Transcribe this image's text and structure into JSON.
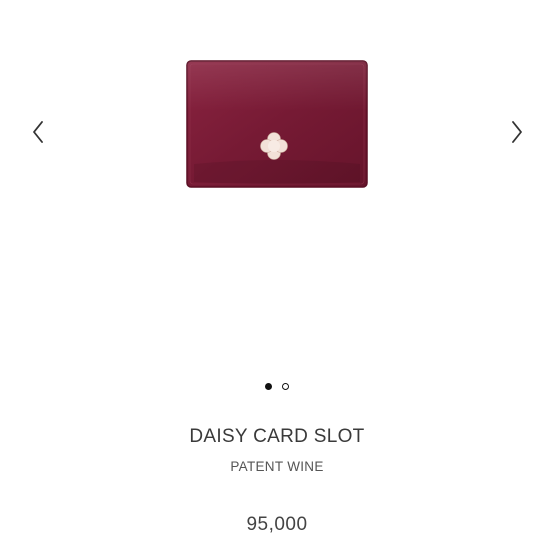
{
  "carousel": {
    "prev_icon": "chevron-left-icon",
    "next_icon": "chevron-right-icon",
    "slide_count": 2,
    "active_index": 0
  },
  "product": {
    "name": "DAISY CARD SLOT",
    "variant": "PATENT WINE",
    "price": "95,000",
    "image": {
      "description": "wine patent leather card holder with flower hardware",
      "color": "#7a1b35",
      "hardware_color": "#f2e1d8"
    }
  }
}
